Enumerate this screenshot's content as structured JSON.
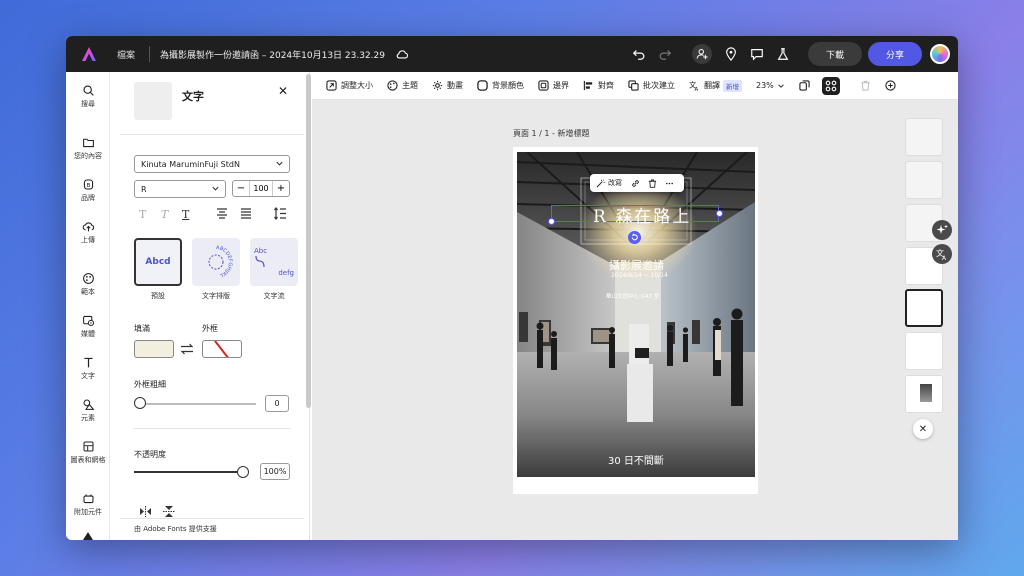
{
  "topbar": {
    "file_label": "檔案",
    "doc_title": "為攝影展製作一份邀請函 – 2024年10月13日 23.32.29",
    "download_label": "下載",
    "share_label": "分享"
  },
  "rail": {
    "items": [
      {
        "label": "搜尋",
        "icon": "search-icon"
      },
      {
        "label": "您的內容",
        "icon": "folder-icon"
      },
      {
        "label": "品牌",
        "icon": "brand-icon"
      },
      {
        "label": "上傳",
        "icon": "upload-icon"
      },
      {
        "label": "範本",
        "icon": "template-icon"
      },
      {
        "label": "媒體",
        "icon": "media-icon"
      },
      {
        "label": "文字",
        "icon": "text-icon"
      },
      {
        "label": "元素",
        "icon": "shapes-icon"
      },
      {
        "label": "圖表和網格",
        "icon": "grid-icon"
      },
      {
        "label": "附加元件",
        "icon": "addons-icon"
      }
    ]
  },
  "panel": {
    "title": "文字",
    "font_family": "Kinuta MaruminFuji StdN",
    "font_weight": "R",
    "font_size": "100",
    "styles": [
      {
        "label": "預設",
        "preview": "Abcd"
      },
      {
        "label": "文字排版",
        "preview": "ABCDEFGHIJKL"
      },
      {
        "label": "文字流",
        "preview_top": "Abc",
        "preview_bottom": "defg"
      }
    ],
    "fill_label": "填滿",
    "stroke_label": "外框",
    "fill_color": "#f3efde",
    "stroke_weight_label": "外框粗細",
    "stroke_weight_value": "0",
    "opacity_label": "不透明度",
    "opacity_value": "100%",
    "opacity_level": 1.0,
    "footer": "由 Adobe Fonts 提供支援"
  },
  "toolbar": {
    "items": [
      {
        "label": "調整大小",
        "icon": "resize-icon"
      },
      {
        "label": "主題",
        "icon": "palette-icon"
      },
      {
        "label": "動畫",
        "icon": "animation-icon"
      },
      {
        "label": "背景顏色",
        "icon": "background-icon"
      },
      {
        "label": "邊界",
        "icon": "border-icon"
      },
      {
        "label": "對齊",
        "icon": "align-icon"
      },
      {
        "label": "批次建立",
        "icon": "batch-icon"
      },
      {
        "label": "翻譯",
        "icon": "translate-icon"
      }
    ],
    "new_badge": "新增",
    "zoom": "23%"
  },
  "canvas": {
    "page_label": "頁面 1 / 1 - 新增標題",
    "context_menu": {
      "rewrite": "改寫"
    },
    "poster": {
      "title": "R 森在路上",
      "subtitle": "攝影展邀請",
      "date": "2024/8/14 ~ 10/14",
      "venue": "華山文創中心 G42 室",
      "footer": "30 日不間斷"
    }
  },
  "colors": {
    "accent": "#5258e3",
    "topbar": "#1f1f1f",
    "selection": "#5a5ff0"
  }
}
